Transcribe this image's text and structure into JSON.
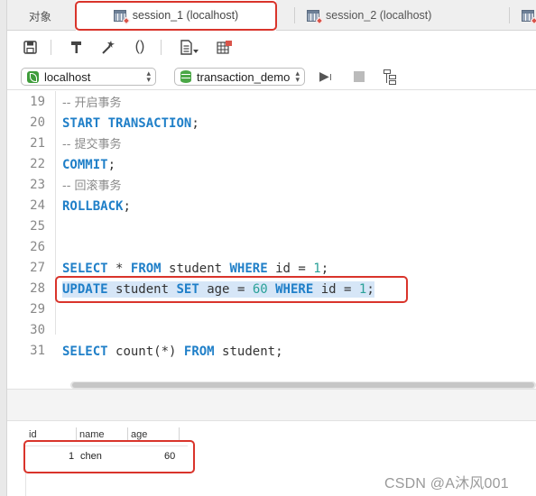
{
  "tabs": [
    {
      "label": "对象"
    },
    {
      "label": "session_1 (localhost)"
    },
    {
      "label": "session_2 (localhost)"
    }
  ],
  "toolbar": {
    "icons": [
      "save-icon",
      "hammer-icon",
      "magic-wand-icon",
      "parentheses-icon",
      "document-icon",
      "grid-export-icon"
    ],
    "parentheses_glyph": "()"
  },
  "connection": {
    "host": "localhost",
    "database": "transaction_demo"
  },
  "editor": {
    "lines": [
      {
        "n": "19",
        "comment": "-- 开启事务"
      },
      {
        "n": "20"
      },
      {
        "n": "21",
        "comment": "-- 提交事务"
      },
      {
        "n": "22"
      },
      {
        "n": "23",
        "comment": "-- 回滚事务"
      },
      {
        "n": "24"
      },
      {
        "n": "25"
      },
      {
        "n": "26"
      },
      {
        "n": "27"
      },
      {
        "n": "28"
      },
      {
        "n": "29"
      },
      {
        "n": "30"
      },
      {
        "n": "31"
      }
    ],
    "tokens": {
      "start": "START",
      "transaction": "TRANSACTION",
      "semi": ";",
      "commit": "COMMIT",
      "rollback": "ROLLBACK",
      "select": "SELECT",
      "star": "*",
      "from": "FROM",
      "student": "student",
      "where": "WHERE",
      "id": "id",
      "eq": "=",
      "one": "1",
      "update": "UPDATE",
      "set": "SET",
      "age": "age",
      "sixty": "60",
      "count": "count(*)"
    }
  },
  "results": {
    "columns": [
      "id",
      "name",
      "age"
    ],
    "rows": [
      {
        "id": "1",
        "name": "chen",
        "age": "60"
      }
    ]
  },
  "watermark": "CSDN @A沐风001"
}
